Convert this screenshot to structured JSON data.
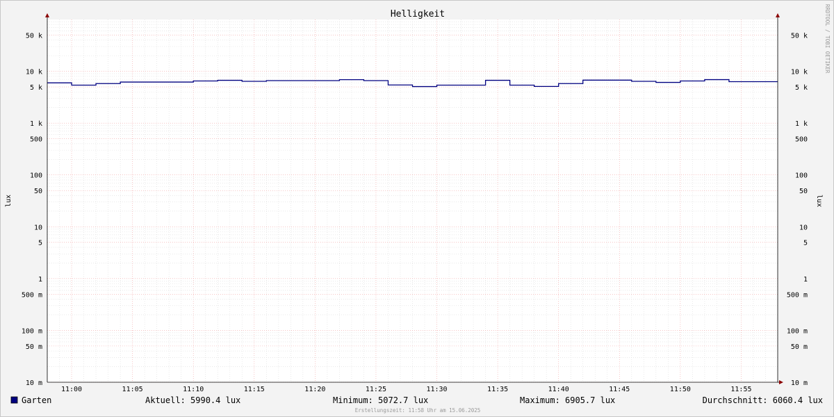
{
  "chart_data": {
    "type": "line",
    "title": "Helligkeit",
    "ylabel": "lux",
    "y_scale": "log",
    "ylim": [
      0.01,
      100000
    ],
    "xlim": [
      "10:58",
      "11:58"
    ],
    "x_ticks": [
      "11:00",
      "11:05",
      "11:10",
      "11:15",
      "11:20",
      "11:25",
      "11:30",
      "11:35",
      "11:40",
      "11:45",
      "11:50",
      "11:55"
    ],
    "y_ticks": [
      {
        "value": 50000,
        "label": "50 k"
      },
      {
        "value": 10000,
        "label": "10 k"
      },
      {
        "value": 5000,
        "label": "5 k"
      },
      {
        "value": 1000,
        "label": "1 k"
      },
      {
        "value": 500,
        "label": "500"
      },
      {
        "value": 100,
        "label": "100"
      },
      {
        "value": 50,
        "label": "50"
      },
      {
        "value": 10,
        "label": "10"
      },
      {
        "value": 5,
        "label": "5"
      },
      {
        "value": 1,
        "label": "1"
      },
      {
        "value": 0.5,
        "label": "500 m"
      },
      {
        "value": 0.1,
        "label": "100 m"
      },
      {
        "value": 0.05,
        "label": "50 m"
      },
      {
        "value": 0.01,
        "label": "10 m"
      }
    ],
    "grid": true,
    "series": [
      {
        "name": "Garten",
        "color": "#000080",
        "step": true,
        "x": [
          "10:58",
          "11:00",
          "11:02",
          "11:04",
          "11:08",
          "11:10",
          "11:12",
          "11:14",
          "11:16",
          "11:20",
          "11:22",
          "11:24",
          "11:26",
          "11:28",
          "11:30",
          "11:32",
          "11:34",
          "11:36",
          "11:38",
          "11:40",
          "11:42",
          "11:44",
          "11:46",
          "11:48",
          "11:50",
          "11:52",
          "11:54",
          "11:56"
        ],
        "values": [
          5990,
          5400,
          5800,
          6200,
          6200,
          6500,
          6700,
          6400,
          6600,
          6600,
          6900,
          6600,
          5450,
          5070,
          5400,
          5400,
          6700,
          5400,
          5100,
          5800,
          6750,
          6750,
          6400,
          6100,
          6500,
          6906,
          6300,
          6300
        ]
      }
    ]
  },
  "legend": {
    "series_name": "Garten",
    "series_color": "#000080",
    "current": "Aktuell: 5990.4 lux",
    "minimum": "Minimum: 5072.7 lux",
    "maximum": "Maximum: 6905.7 lux",
    "average": "Durchschnitt: 6060.4 lux"
  },
  "footer": "Erstellungszeit: 11:58 Uhr am 15.06.2025",
  "watermark": "RRDTOOL / TOBI OETIKER"
}
